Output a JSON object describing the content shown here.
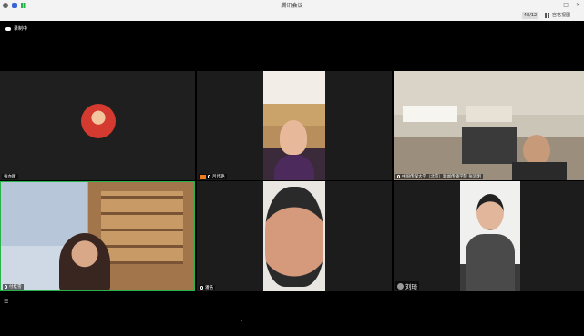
{
  "window": {
    "title": "腾讯会议"
  },
  "toolbar": {
    "viewer_count": "48/12",
    "view_mode_label": "宫格视图",
    "icons": [
      "info-icon",
      "shield-icon",
      "signal-icon",
      "minimize-icon",
      "maximize-icon",
      "close-icon"
    ]
  },
  "recording": {
    "label": "录制中"
  },
  "participants": [
    {
      "name": "张亦睛",
      "camera": "off",
      "avatar_color": "#d43a2f"
    },
    {
      "name": "吕佳艳",
      "camera": "on",
      "muted_icon": "camera-off-icon"
    },
    {
      "name": "中国传媒大学（北京）新闻传播学院 张思明",
      "camera": "on"
    },
    {
      "name": "付桂雪",
      "camera": "on"
    },
    {
      "name": "潘浩",
      "camera": "on"
    },
    {
      "name": "刘琦",
      "camera": "on",
      "speaking": true
    }
  ],
  "colors": {
    "accent": "#3a63d8",
    "camera_off": "#f07b1f",
    "tile_bg": "#1f1f1f"
  }
}
